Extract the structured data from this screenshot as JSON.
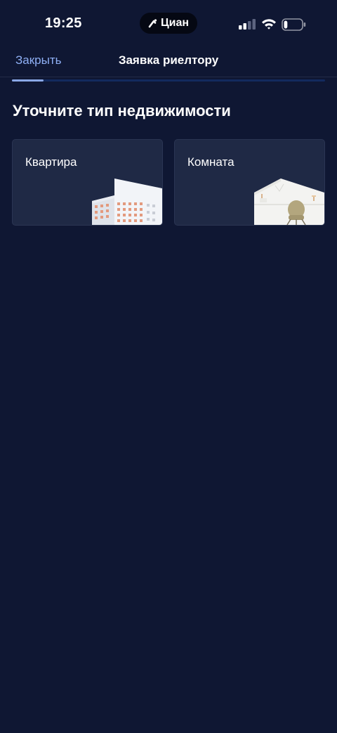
{
  "status_bar": {
    "time": "19:25",
    "app_pill_label": "Циан",
    "signal_icon": "cellular-signal-icon",
    "wifi_icon": "wifi-icon",
    "battery_icon": "battery-icon",
    "battery_level": 0.2
  },
  "nav": {
    "close_label": "Закрыть",
    "title": "Заявка риелтору"
  },
  "progress": {
    "fraction": 0.1,
    "fill_color": "#8aa8e6",
    "track_color": "#132a5e"
  },
  "main": {
    "heading": "Уточните тип недвижимости",
    "cards": [
      {
        "label": "Квартира",
        "icon": "apartment-building-icon"
      },
      {
        "label": "Комната",
        "icon": "room-interior-icon"
      }
    ]
  },
  "colors": {
    "background": "#0f1733",
    "card_background": "#1f2945",
    "accent_link": "#8fb0f5"
  }
}
